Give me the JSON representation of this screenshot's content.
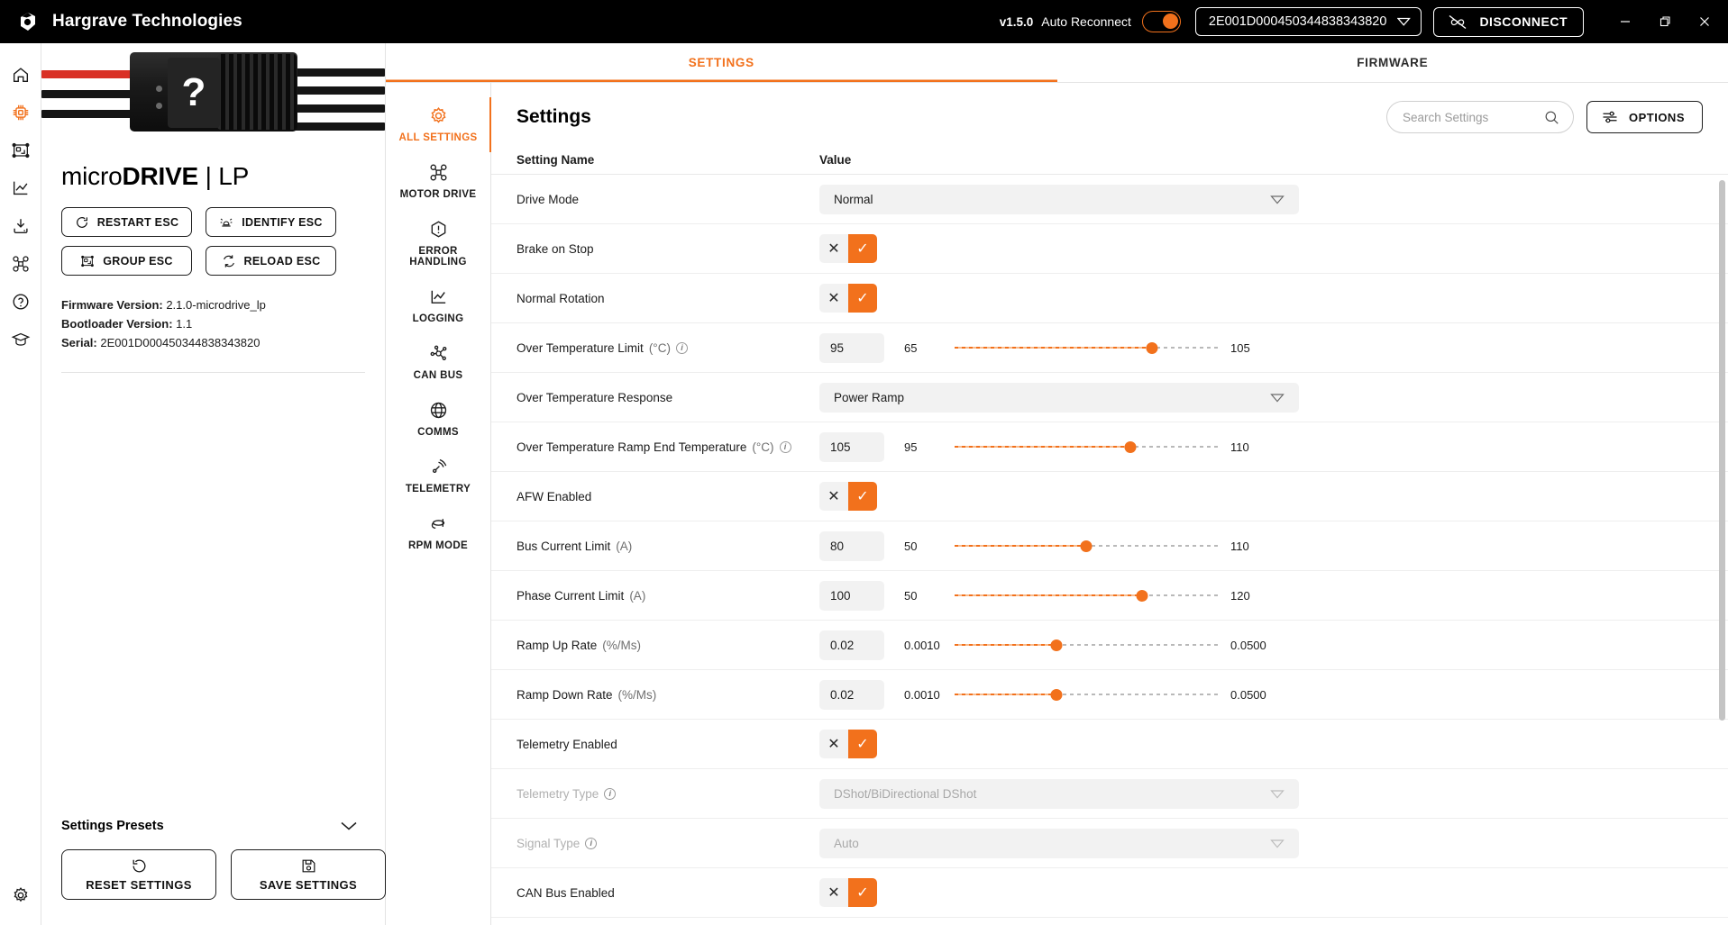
{
  "titlebar": {
    "brand": "Hargrave Technologies",
    "version": "v1.5.0",
    "auto_reconnect_label": "Auto Reconnect",
    "auto_reconnect_on": true,
    "device_id": "2E001D000450344838343820",
    "disconnect_label": "DISCONNECT",
    "accent": "#f2711c"
  },
  "rail": {
    "items": [
      {
        "icon": "home-icon",
        "active": false
      },
      {
        "icon": "chip-icon",
        "active": true
      },
      {
        "icon": "group-frame-icon",
        "active": false
      },
      {
        "icon": "chart-icon",
        "active": false
      },
      {
        "icon": "download-icon",
        "active": false
      },
      {
        "icon": "drone-icon",
        "active": false
      },
      {
        "icon": "help-icon",
        "active": false
      },
      {
        "icon": "graduation-cap-icon",
        "active": false
      }
    ],
    "bottom_icon": "settings-gear-icon"
  },
  "device": {
    "title_prefix": "micro",
    "title_bold": "DRIVE",
    "title_suffix": " | LP",
    "buttons": [
      {
        "label": "RESTART ESC",
        "icon": "restart-icon"
      },
      {
        "label": "IDENTIFY ESC",
        "icon": "beacon-icon"
      },
      {
        "label": "GROUP ESC",
        "icon": "group-frame-icon"
      },
      {
        "label": "RELOAD ESC",
        "icon": "reload-icon"
      }
    ],
    "firmware_version_label": "Firmware Version: ",
    "firmware_version_value": "2.1.0-microdrive_lp",
    "bootloader_version_label": "Bootloader Version: ",
    "bootloader_version_value": "1.1",
    "serial_label": "Serial: ",
    "serial_value": "2E001D000450344838343820",
    "presets_label": "Settings Presets",
    "reset_label": "RESET SETTINGS",
    "save_label": "SAVE SETTINGS",
    "photo_placeholder": "?"
  },
  "tabs": [
    {
      "label": "SETTINGS",
      "active": true
    },
    {
      "label": "FIRMWARE",
      "active": false
    }
  ],
  "categories": [
    {
      "label": "ALL SETTINGS",
      "icon": "gear-icon",
      "active": true
    },
    {
      "label": "MOTOR DRIVE",
      "icon": "drone-icon",
      "active": false
    },
    {
      "label": "ERROR HANDLING",
      "icon": "warning-icon",
      "active": false
    },
    {
      "label": "LOGGING",
      "icon": "chart-icon",
      "active": false
    },
    {
      "label": "CAN BUS",
      "icon": "network-icon",
      "active": false
    },
    {
      "label": "COMMS",
      "icon": "globe-icon",
      "active": false
    },
    {
      "label": "TELEMETRY",
      "icon": "signal-icon",
      "active": false
    },
    {
      "label": "RPM MODE",
      "icon": "rpm-icon",
      "active": false
    }
  ],
  "settings_panel": {
    "title": "Settings",
    "search_placeholder": "Search Settings",
    "search_value": "",
    "options_label": "OPTIONS",
    "col_name": "Setting Name",
    "col_value": "Value"
  },
  "rows": [
    {
      "name": "Drive Mode",
      "unit": "",
      "info": false,
      "type": "dropdown",
      "value": "Normal",
      "disabled": false
    },
    {
      "name": "Brake on Stop",
      "unit": "",
      "info": false,
      "type": "toggle",
      "value": true,
      "off_label": "✕",
      "on_label": "✓",
      "disabled": false
    },
    {
      "name": "Normal Rotation",
      "unit": "",
      "info": false,
      "type": "toggle",
      "value": true,
      "off_label": "✕",
      "on_label": "✓",
      "disabled": false
    },
    {
      "name": "Over Temperature Limit",
      "unit": "(°C)",
      "info": true,
      "type": "slider",
      "value": "95",
      "min": "65",
      "max": "105",
      "pct": 75,
      "disabled": false
    },
    {
      "name": "Over Temperature Response",
      "unit": "",
      "info": false,
      "type": "dropdown",
      "value": "Power Ramp",
      "disabled": false
    },
    {
      "name": "Over Temperature Ramp End Temperature",
      "unit": "(°C)",
      "info": true,
      "type": "slider",
      "value": "105",
      "min": "95",
      "max": "110",
      "pct": 66.7,
      "disabled": false
    },
    {
      "name": "AFW Enabled",
      "unit": "",
      "info": false,
      "type": "toggle",
      "value": true,
      "off_label": "✕",
      "on_label": "✓",
      "disabled": false
    },
    {
      "name": "Bus Current Limit",
      "unit": "(A)",
      "info": false,
      "type": "slider",
      "value": "80",
      "min": "50",
      "max": "110",
      "pct": 50,
      "disabled": false
    },
    {
      "name": "Phase Current Limit",
      "unit": "(A)",
      "info": false,
      "type": "slider",
      "value": "100",
      "min": "50",
      "max": "120",
      "pct": 71.4,
      "disabled": false
    },
    {
      "name": "Ramp Up Rate",
      "unit": "(%/Ms)",
      "info": false,
      "type": "slider",
      "value": "0.02",
      "min": "0.0010",
      "max": "0.0500",
      "pct": 38.8,
      "disabled": false
    },
    {
      "name": "Ramp Down Rate",
      "unit": "(%/Ms)",
      "info": false,
      "type": "slider",
      "value": "0.02",
      "min": "0.0010",
      "max": "0.0500",
      "pct": 38.8,
      "disabled": false
    },
    {
      "name": "Telemetry Enabled",
      "unit": "",
      "info": false,
      "type": "toggle",
      "value": true,
      "off_label": "✕",
      "on_label": "✓",
      "disabled": false
    },
    {
      "name": "Telemetry Type",
      "unit": "",
      "info": true,
      "type": "dropdown",
      "value": "DShot/BiDirectional DShot",
      "disabled": true
    },
    {
      "name": "Signal Type",
      "unit": "",
      "info": true,
      "type": "dropdown",
      "value": "Auto",
      "disabled": true
    },
    {
      "name": "CAN Bus Enabled",
      "unit": "",
      "info": false,
      "type": "toggle",
      "value": true,
      "off_label": "✕",
      "on_label": "✓",
      "disabled": false
    }
  ],
  "window_controls": {
    "minimize": "–",
    "maximize": "❐",
    "close": "✕"
  }
}
